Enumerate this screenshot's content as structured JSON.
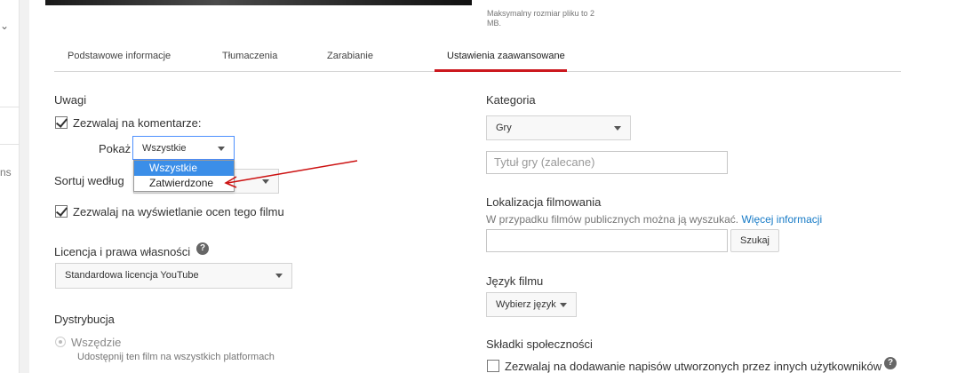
{
  "left_panel": {
    "fragment": "ns"
  },
  "upload": {
    "max_size_text": "Maksymalny rozmiar pliku to 2 MB."
  },
  "tabs": [
    {
      "label": "Podstawowe informacje"
    },
    {
      "label": "Tłumaczenia"
    },
    {
      "label": "Zarabianie"
    },
    {
      "label": "Ustawienia zaawansowane",
      "active": true
    }
  ],
  "comments": {
    "heading": "Uwagi",
    "allow_label": "Zezwalaj na komentarze:",
    "allow_checked": true,
    "show_label": "Pokaż",
    "show_value": "Wszystkie",
    "dropdown_options": [
      "Wszystkie",
      "Zatwierdzone"
    ],
    "sort_label": "Sortuj według",
    "ratings_label": "Zezwalaj na wyświetlanie ocen tego filmu",
    "ratings_checked": true
  },
  "license": {
    "heading": "Licencja i prawa własności",
    "help_icon": "question-icon",
    "value": "Standardowa licencja YouTube"
  },
  "distribution": {
    "heading": "Dystrybucja",
    "option_label": "Wszędzie",
    "option_desc": "Udostępnij ten film na wszystkich platformach"
  },
  "category": {
    "heading": "Kategoria",
    "value": "Gry",
    "game_title_placeholder": "Tytuł gry (zalecane)"
  },
  "location": {
    "heading": "Lokalizacja filmowania",
    "help_text": "W przypadku filmów publicznych można ją wyszukać.",
    "more_link": "Więcej informacji",
    "search_button": "Szukaj"
  },
  "language": {
    "heading": "Język filmu",
    "select_label": "Wybierz język"
  },
  "community": {
    "heading": "Składki społeczności",
    "subtitles_label": "Zezwalaj na dodawanie napisów utworzonych przez innych użytkowników",
    "help_icon": "question-icon"
  },
  "colors": {
    "tab_active": "#cc181e",
    "link": "#167ac6",
    "dropdown_highlight": "#3b8ee8",
    "annotation_arrow": "#cc1111"
  }
}
